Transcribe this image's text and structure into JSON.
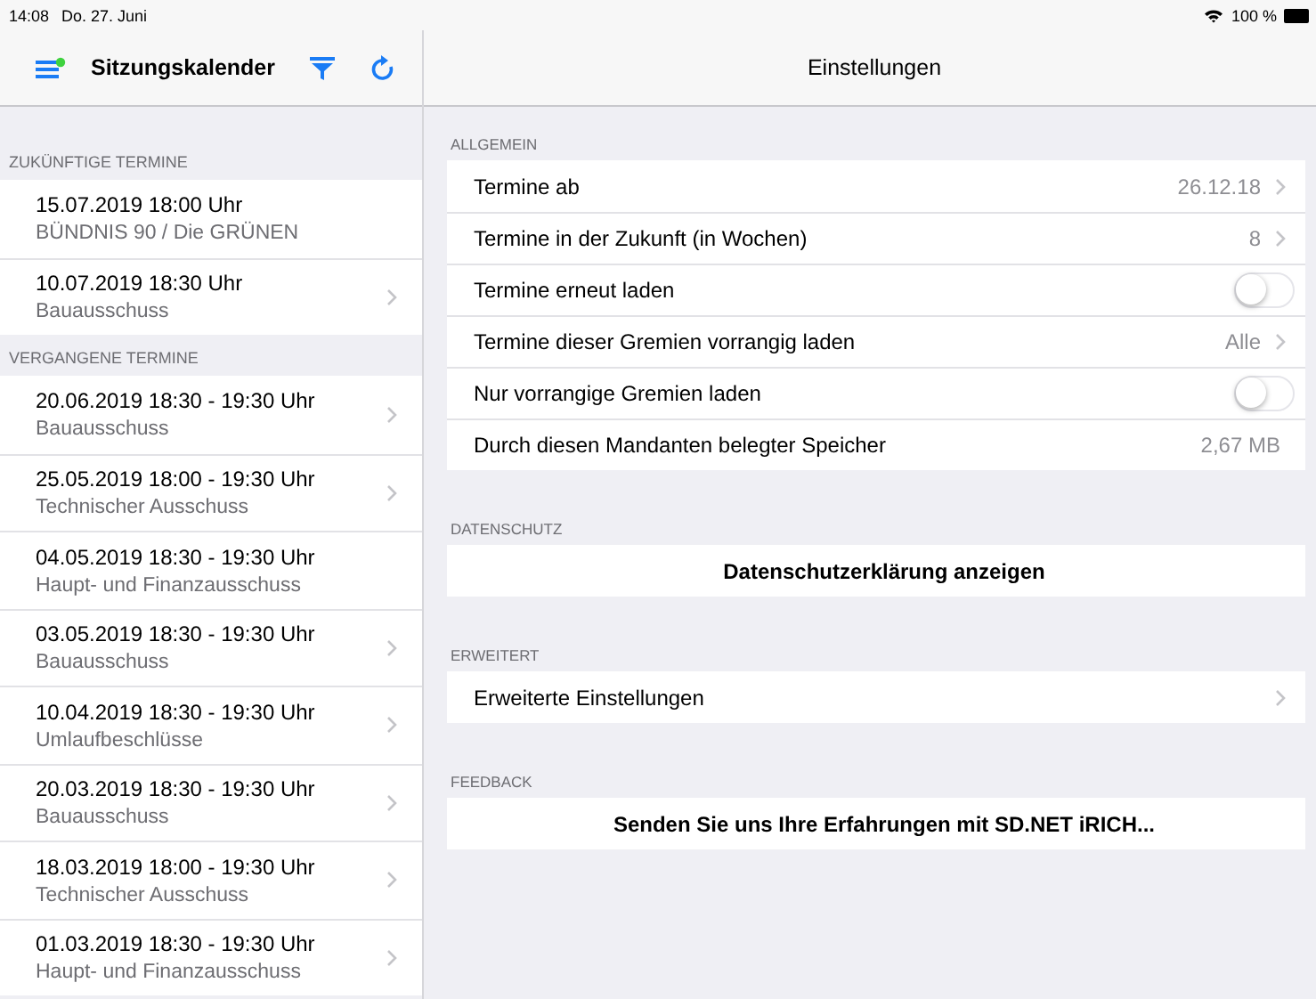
{
  "status_bar": {
    "time": "14:08",
    "date": "Do. 27. Juni",
    "battery": "100 %"
  },
  "sidebar": {
    "title": "Sitzungskalender",
    "sections": [
      {
        "header": "ZUKÜNFTIGE TERMINE",
        "items": [
          {
            "date": "15.07.2019 18:00 Uhr",
            "committee": "BÜNDNIS 90 / Die GRÜNEN",
            "chevron": false
          },
          {
            "date": "10.07.2019 18:30 Uhr",
            "committee": "Bauausschuss",
            "chevron": true
          }
        ]
      },
      {
        "header": "VERGANGENE TERMINE",
        "items": [
          {
            "date": "20.06.2019 18:30 -  19:30 Uhr",
            "committee": "Bauausschuss",
            "chevron": true
          },
          {
            "date": "25.05.2019 18:00 -  19:30 Uhr",
            "committee": "Technischer Ausschuss",
            "chevron": true
          },
          {
            "date": "04.05.2019 18:30 -  19:30 Uhr",
            "committee": "Haupt- und Finanzausschuss",
            "chevron": false
          },
          {
            "date": "03.05.2019 18:30 -  19:30 Uhr",
            "committee": "Bauausschuss",
            "chevron": true
          },
          {
            "date": "10.04.2019 18:30 -  19:30 Uhr",
            "committee": "Umlaufbeschlüsse",
            "chevron": true
          },
          {
            "date": "20.03.2019 18:30 -  19:30 Uhr",
            "committee": "Bauausschuss",
            "chevron": true
          },
          {
            "date": "18.03.2019 18:00 -  19:30 Uhr",
            "committee": "Technischer Ausschuss",
            "chevron": true
          },
          {
            "date": "01.03.2019 18:30 -  19:30 Uhr",
            "committee": "Haupt- und Finanzausschuss",
            "chevron": true
          }
        ]
      }
    ]
  },
  "settings": {
    "title": "Einstellungen",
    "sections": [
      {
        "header": "ALLGEMEIN",
        "rows": [
          {
            "kind": "value",
            "label": "Termine ab",
            "value": "26.12.18"
          },
          {
            "kind": "value",
            "label": "Termine in der Zukunft (in Wochen)",
            "value": "8"
          },
          {
            "kind": "toggle",
            "label": "Termine erneut laden",
            "on": false
          },
          {
            "kind": "value",
            "label": "Termine dieser Gremien vorrangig laden",
            "value": "Alle"
          },
          {
            "kind": "toggle",
            "label": "Nur vorrangige Gremien laden",
            "on": false
          },
          {
            "kind": "info",
            "label": "Durch diesen Mandanten belegter Speicher",
            "value": "2,67 MB"
          }
        ]
      },
      {
        "header": "DATENSCHUTZ",
        "rows": [
          {
            "kind": "action",
            "label": "Datenschutzerklärung anzeigen"
          }
        ]
      },
      {
        "header": "ERWEITERT",
        "rows": [
          {
            "kind": "link",
            "label": "Erweiterte Einstellungen"
          }
        ]
      },
      {
        "header": "FEEDBACK",
        "rows": [
          {
            "kind": "action",
            "label": "Senden Sie uns Ihre Erfahrungen mit SD.NET iRICH..."
          }
        ]
      }
    ]
  }
}
